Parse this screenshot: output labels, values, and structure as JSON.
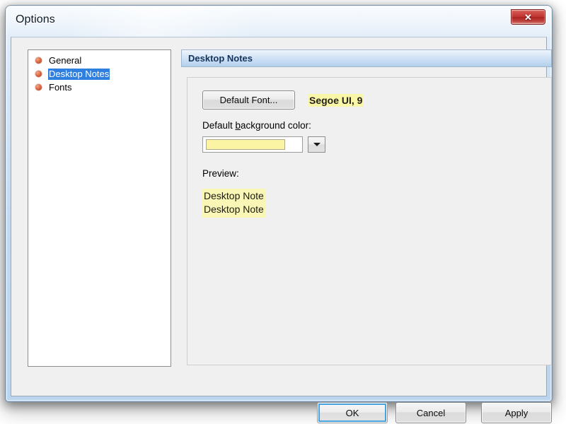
{
  "window": {
    "title": "Options",
    "close_icon": "close-x-icon",
    "close_label": "✕"
  },
  "sidebar": {
    "items": [
      {
        "label": "General",
        "selected": false,
        "bullet_icon": "orange-bullet-icon"
      },
      {
        "label": "Desktop Notes",
        "selected": true,
        "bullet_icon": "orange-bullet-icon"
      },
      {
        "label": "Fonts",
        "selected": false,
        "bullet_icon": "orange-bullet-icon"
      }
    ]
  },
  "section": {
    "header": "Desktop Notes"
  },
  "form": {
    "default_font_button": "Default Font...",
    "default_font_value": "Segoe UI, 9",
    "bgcolor_label_before": "Default ",
    "bgcolor_label_accel": "b",
    "bgcolor_label_after": "ackground color:",
    "bgcolor_swatch_value": "#FBF4A4",
    "dropdown_icon": "chevron-down-icon",
    "preview_label": "Preview:",
    "preview_line_1": "Desktop Note",
    "preview_line_2": "Desktop Note",
    "preview_background": "#FAF6B6"
  },
  "footer": {
    "ok": "OK",
    "cancel": "Cancel",
    "apply": "Apply"
  },
  "colors": {
    "accent_blue": "#2F7FE0",
    "header_text": "#14335C",
    "focus_ring": "#46A3DD",
    "close_red": "#BF3530",
    "bullet_orange": "#E0714C",
    "highlight_yellow": "#FAF6A8"
  }
}
